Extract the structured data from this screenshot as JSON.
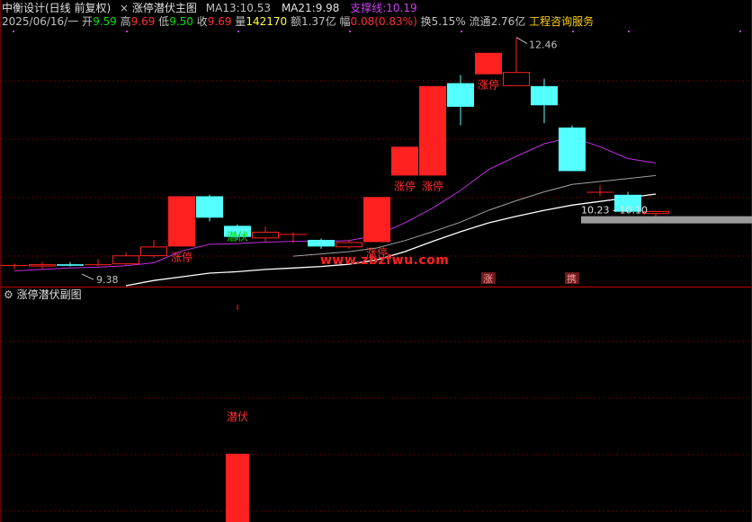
{
  "header": {
    "title": "中衡设计(日线 前复权)",
    "close_symbol": "×",
    "indicator_name": "涨停潜伏主图",
    "ma13_label": "MA13:",
    "ma13_value": "10.53",
    "ma21_label": "MA21:",
    "ma21_value": "9.98",
    "support_label": "支撑线:",
    "support_value": "10.19",
    "line2": {
      "date": "2025/06/16/一",
      "open_label": "开",
      "open": "9.59",
      "high_label": "高",
      "high": "9.69",
      "low_label": "低",
      "low": "9.50",
      "close_label": "收",
      "close": "9.69",
      "vol_label": "量",
      "vol": "142170",
      "amt_label": "额",
      "amt": "1.37亿",
      "chg_label": "幅",
      "chg": "0.08(0.83%)",
      "turn_label": "换",
      "turn": "5.15%",
      "float_label": "流通",
      "float": "2.76亿",
      "service": "工程咨询服务"
    }
  },
  "watermark": "www.zbzfwu.com",
  "sub_panel": {
    "icon": "gear-icon",
    "title": "涨停潜伏副图",
    "label": "潜伏"
  },
  "colors": {
    "up": "#ff2020",
    "down": "#54ffff",
    "ma13": "#c030e0",
    "ma21": "#a0a0a0",
    "support": "#ffffff",
    "grid": "#6a0000"
  },
  "chart_data": {
    "type": "candlestick",
    "ylim": [
      9.1,
      12.6
    ],
    "candles": [
      {
        "o": 9.38,
        "h": 9.4,
        "l": 9.32,
        "c": 9.38
      },
      {
        "o": 9.36,
        "h": 9.42,
        "l": 9.33,
        "c": 9.39
      },
      {
        "o": 9.39,
        "h": 9.42,
        "l": 9.36,
        "c": 9.37
      },
      {
        "o": 9.39,
        "h": 9.46,
        "l": 9.36,
        "c": 9.39
      },
      {
        "o": 9.39,
        "h": 9.55,
        "l": 9.38,
        "c": 9.51
      },
      {
        "o": 9.5,
        "h": 9.72,
        "l": 9.48,
        "c": 9.63
      },
      {
        "o": 9.63,
        "h": 10.31,
        "l": 9.63,
        "c": 10.31
      },
      {
        "o": 10.31,
        "h": 10.33,
        "l": 9.97,
        "c": 10.02
      },
      {
        "o": 9.91,
        "h": 9.93,
        "l": 9.72,
        "c": 9.76
      },
      {
        "o": 9.74,
        "h": 9.9,
        "l": 9.7,
        "c": 9.83
      },
      {
        "o": 9.8,
        "h": 9.82,
        "l": 9.68,
        "c": 9.8
      },
      {
        "o": 9.72,
        "h": 9.74,
        "l": 9.6,
        "c": 9.63
      },
      {
        "o": 9.62,
        "h": 9.72,
        "l": 9.6,
        "c": 9.69
      },
      {
        "o": 9.69,
        "h": 10.3,
        "l": 9.69,
        "c": 10.3
      },
      {
        "o": 10.59,
        "h": 10.98,
        "l": 10.59,
        "c": 10.98
      },
      {
        "o": 10.59,
        "h": 11.8,
        "l": 10.59,
        "c": 11.8
      },
      {
        "o": 11.84,
        "h": 11.95,
        "l": 11.27,
        "c": 11.52
      },
      {
        "o": 11.96,
        "h": 12.25,
        "l": 11.96,
        "c": 12.25
      },
      {
        "o": 11.8,
        "h": 12.46,
        "l": 11.8,
        "c": 11.99
      },
      {
        "o": 11.8,
        "h": 11.9,
        "l": 11.3,
        "c": 11.54
      },
      {
        "o": 11.24,
        "h": 11.27,
        "l": 10.65,
        "c": 10.65
      },
      {
        "o": 10.37,
        "h": 10.46,
        "l": 10.31,
        "c": 10.37
      },
      {
        "o": 10.33,
        "h": 10.37,
        "l": 10.08,
        "c": 10.1
      },
      {
        "o": 10.07,
        "h": 10.11,
        "l": 10.02,
        "c": 10.11
      }
    ],
    "ma13": [
      9.3,
      9.32,
      9.34,
      9.35,
      9.37,
      9.41,
      9.57,
      9.66,
      9.67,
      9.69,
      9.7,
      9.7,
      9.71,
      9.78,
      9.95,
      10.15,
      10.39,
      10.67,
      10.85,
      11.02,
      11.11,
      10.98,
      10.82,
      10.76
    ],
    "ma21": [
      null,
      null,
      null,
      null,
      null,
      null,
      null,
      null,
      null,
      null,
      9.5,
      9.53,
      9.56,
      9.61,
      9.71,
      9.83,
      9.96,
      10.12,
      10.25,
      10.37,
      10.47,
      10.51,
      10.55,
      10.59
    ],
    "support": [
      null,
      null,
      null,
      null,
      9.1,
      9.17,
      9.22,
      9.27,
      9.29,
      9.32,
      9.34,
      9.36,
      9.39,
      9.45,
      9.56,
      9.7,
      9.83,
      9.95,
      10.04,
      10.12,
      10.19,
      10.24,
      10.29,
      10.34
    ],
    "annotations": [
      {
        "i": 1,
        "text": "9.38"
      },
      {
        "i": 18,
        "text": "12.46"
      },
      {
        "text": "10.23 - 10.10"
      }
    ],
    "signals": [
      {
        "i": 6,
        "text": "涨停"
      },
      {
        "i": 8,
        "text": "潜伏"
      },
      {
        "i": 13,
        "text": "涨停"
      },
      {
        "i": 14,
        "text": "涨停"
      },
      {
        "i": 15,
        "text": "涨停"
      },
      {
        "i": 17,
        "text": "涨停"
      }
    ],
    "bottom_marks": [
      {
        "i": 17,
        "text": "涨"
      },
      {
        "i": 20,
        "text": "携"
      }
    ]
  }
}
